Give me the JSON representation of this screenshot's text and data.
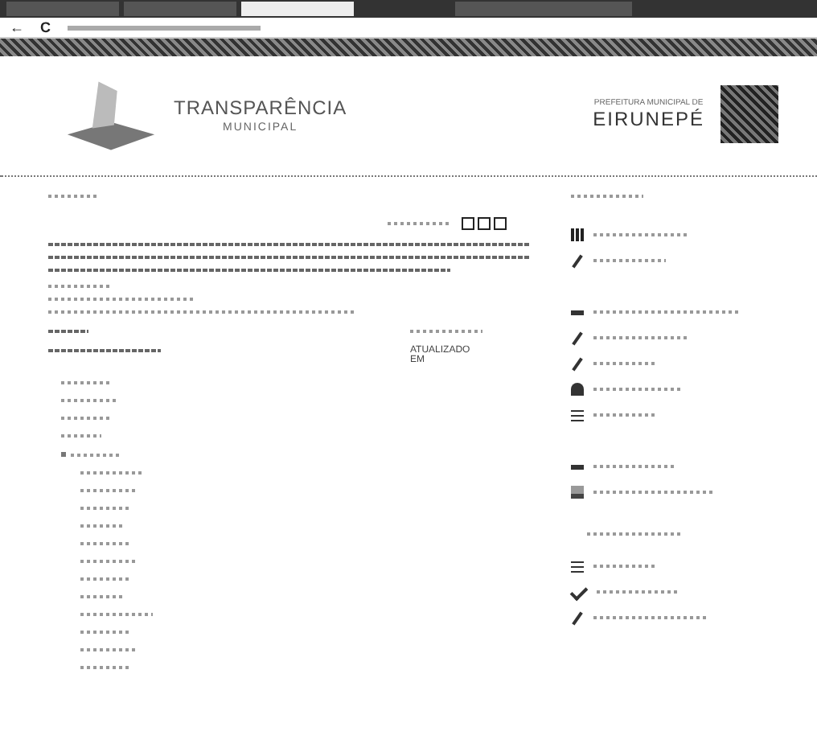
{
  "browser": {
    "tabs": [
      {
        "selected": false
      },
      {
        "selected": false
      },
      {
        "selected": true
      },
      {
        "selected": false
      }
    ],
    "back": "←",
    "reload": "C"
  },
  "header": {
    "title": "TRANSPARÊNCIA",
    "subtitle": "MUNICIPAL",
    "city_prefix": "PREFEITURA MUNICIPAL DE",
    "city": "EIRUNEPÉ"
  },
  "content": {
    "updated_label": "ATUALIZADO EM"
  }
}
